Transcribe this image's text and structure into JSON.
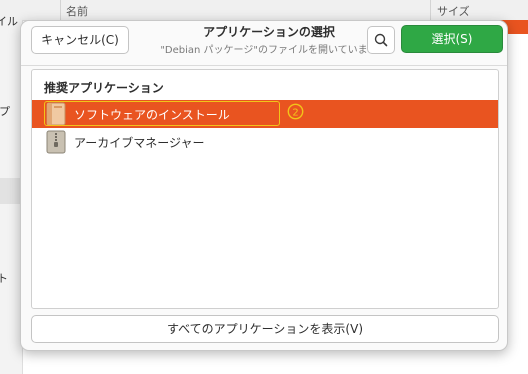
{
  "background": {
    "columns": {
      "name": "名前",
      "size": "サイズ"
    },
    "sidebar_fragments": [
      "ファイル",
      "プ",
      "ト"
    ]
  },
  "dialog": {
    "title": "アプリケーションの選択",
    "subtitle": "\"Debian パッケージ\"のファイルを開いています",
    "cancel_label": "キャンセル(C)",
    "select_label": "選択(S)",
    "search_icon": "search-icon",
    "section_title": "推奨アプリケーション",
    "apps": [
      {
        "label": "ソフトウェアのインストール",
        "icon": "software-install-icon",
        "selected": true
      },
      {
        "label": "アーカイブマネージャー",
        "icon": "archive-manager-icon",
        "selected": false
      }
    ],
    "annotation_marker": "②",
    "show_all_label": "すべてのアプリケーションを表示(V)"
  },
  "colors": {
    "accent": "#e95420",
    "select_button": "#2fa845",
    "highlight": "#f2c419"
  }
}
